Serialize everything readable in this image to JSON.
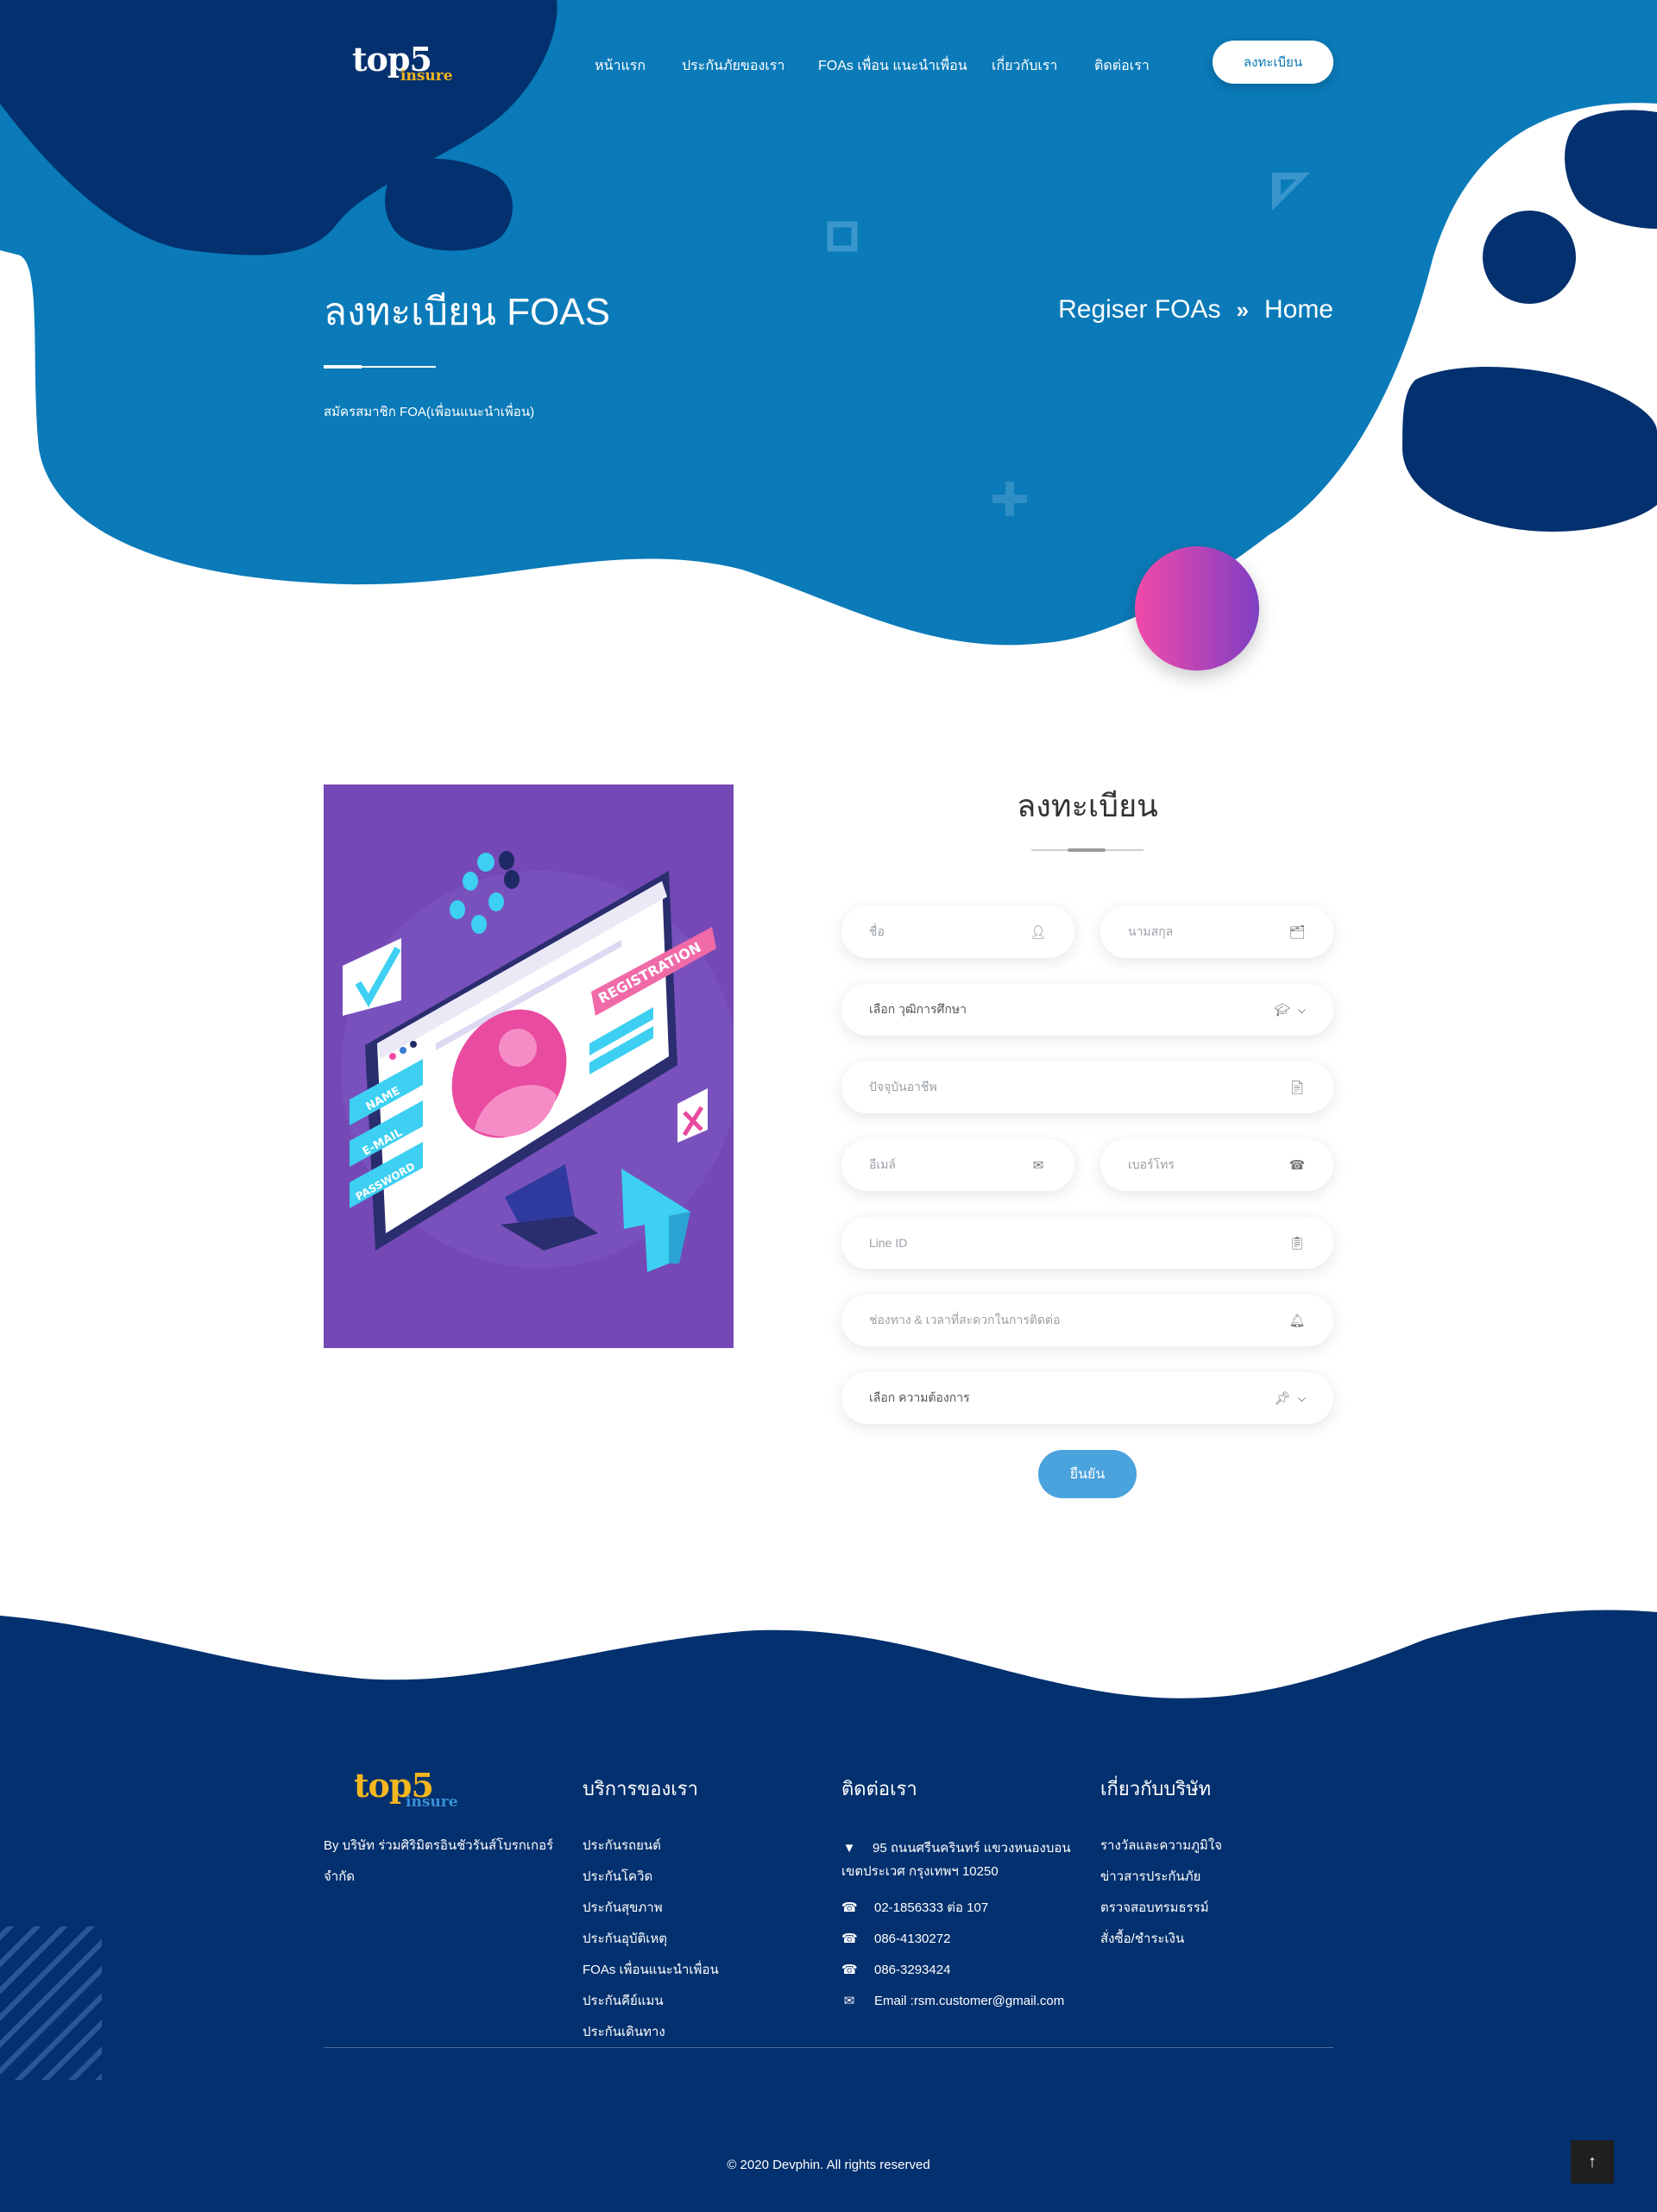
{
  "colors": {
    "hero_blue": "#0a7ab8",
    "navy": "#03306e",
    "pink_gradient_start": "#f34aa8",
    "pink_gradient_end": "#7e3fc3",
    "illustration_bg": "#7449b5",
    "submit_blue": "#4aa3dd",
    "logo_yellow": "#f5b71f"
  },
  "header": {
    "logo": {
      "top": "top5",
      "bottom": "insure"
    },
    "nav": [
      "หน้าแรก",
      "ประกันภัยของเรา",
      "FOAs เพื่อน แนะนำเพื่อน",
      "เกี่ยวกับเรา",
      "ติดต่อเรา"
    ],
    "register_button": "ลงทะเบียน"
  },
  "hero": {
    "title": "ลงทะเบียน FOAS",
    "subtitle": "สมัครสมาชิก FOA(เพื่อนแนะนำเพื่อน)",
    "breadcrumb": {
      "current": "Regiser FOAs",
      "separator": "»",
      "home": "Home"
    }
  },
  "illustration": {
    "labels": [
      "NAME",
      "E-MAIL",
      "PASSWORD",
      "REGISTRATION"
    ]
  },
  "form": {
    "title": "ลงทะเบียน",
    "fields": {
      "first_name": {
        "placeholder": "ชื่อ",
        "icon": "user-icon"
      },
      "last_name": {
        "placeholder": "นามสกุล",
        "icon": "id-card-icon"
      },
      "education": {
        "value": "เลือก วุฒิการศึกษา",
        "icon": "graduation-cap-icon"
      },
      "occupation": {
        "placeholder": "ปัจจุบันอาชีพ",
        "icon": "file-icon"
      },
      "email": {
        "placeholder": "อีเมล์",
        "icon": "envelope-icon"
      },
      "phone": {
        "placeholder": "เบอร์โทร",
        "icon": "phone-icon"
      },
      "line_id": {
        "placeholder": "Line ID",
        "icon": "clipboard-icon"
      },
      "contact_time": {
        "placeholder": "ช่องทาง & เวลาที่สะดวกในการติดต่อ",
        "icon": "bell-icon"
      },
      "need": {
        "value": "เลือก ความต้องการ",
        "icon": "pin-icon"
      }
    },
    "submit": "ยืนยัน"
  },
  "footer": {
    "logo": {
      "top": "top5",
      "bottom": "insure"
    },
    "company_lines": [
      "By บริษัท ร่วมศิริมิตรอินชัวรันส์โบรกเกอร์",
      "จำกัด"
    ],
    "services": {
      "heading": "บริการของเรา",
      "items": [
        "ประกันรถยนต์",
        "ประกันโควิด",
        "ประกันสุขภาพ",
        "ประกันอุบัติเหตุ",
        "FOAs เพื่อนแนะนำเพื่อน",
        "ประกันคีย์แมน",
        "ประกันเดินทาง"
      ]
    },
    "contact": {
      "heading": "ติดต่อเรา",
      "address_lines": [
        "95 ถนนศรีนครินทร์ แขวงหนองบอน",
        "เขตประเวศ กรุงเทพฯ 10250"
      ],
      "phones": [
        "02-1856333 ต่อ 107",
        "086-4130272",
        "086-3293424"
      ],
      "email": "Email :rsm.customer@gmail.com"
    },
    "about": {
      "heading": "เกี่ยวกับบริษัท",
      "items": [
        "รางวัลและความภูมิใจ",
        "ข่าวสารประกันภัย",
        "ตรวจสอบทรมธรรม์",
        "สั่งซื้อ/ชำระเงิน"
      ]
    },
    "copyright": "© 2020 Devphin. All rights reserved"
  }
}
